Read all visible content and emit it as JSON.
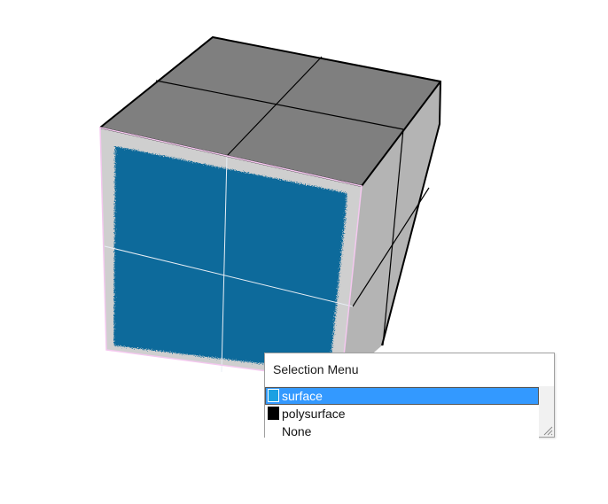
{
  "viewport": {
    "colors": {
      "top_face": "#7f7f7f",
      "right_face": "#b4b4b4",
      "front_face": "#0c6b9b",
      "front_face_rim": "#cfcfcf",
      "edge": "#000000",
      "highlight_edge": "#f4c8ef"
    }
  },
  "selection_menu": {
    "title": "Selection Menu",
    "items": [
      {
        "label": "surface",
        "swatch_color": "#1ba1e2",
        "selected": true
      },
      {
        "label": "polysurface",
        "swatch_color": "#000000",
        "selected": false
      },
      {
        "label": "None",
        "swatch_color": null,
        "selected": false
      }
    ],
    "selection_color": "#3399ff",
    "resize_grip_icon": "resize-grip-icon"
  }
}
